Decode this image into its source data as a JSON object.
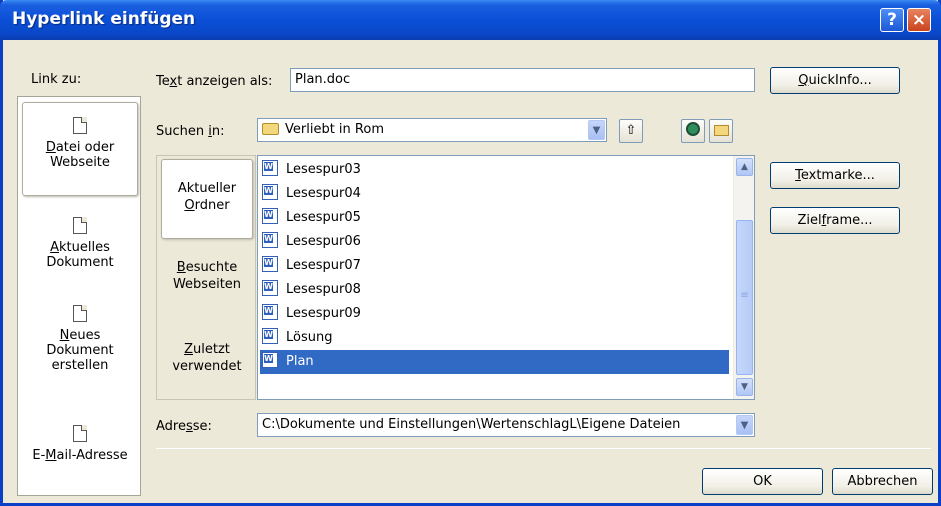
{
  "window": {
    "title": "Hyperlink einfügen",
    "help_glyph": "?",
    "close_glyph": "×"
  },
  "link_to": {
    "label": "Link zu:",
    "items": [
      {
        "l1": "Datei oder",
        "l2": "Webseite",
        "ul": "D",
        "rest": "atei oder",
        "icon": "file-web-icon",
        "selected": true
      },
      {
        "ul": "A",
        "rest": "ktuelles",
        "l2": "Dokument",
        "icon": "current-document-icon",
        "selected": false
      },
      {
        "ul": "N",
        "rest": "eues",
        "l2": "Dokument",
        "l3": "erstellen",
        "icon": "new-document-icon",
        "selected": false
      },
      {
        "pre": "E-",
        "ul": "M",
        "rest": "ail-Adresse",
        "icon": "email-icon",
        "selected": false
      }
    ]
  },
  "display_text": {
    "label_pre": "Te",
    "label_ul": "x",
    "label_post": "t anzeigen als:",
    "value": "Plan.doc"
  },
  "quickinfo_button": {
    "ul": "Q",
    "rest": "uickInfo..."
  },
  "look_in": {
    "label_pre": "Suchen ",
    "label_ul": "i",
    "label_post": "n:",
    "value": "Verliebt in Rom"
  },
  "side_tabs": [
    {
      "l1": "Aktueller",
      "ul": "O",
      "rest": "rdner",
      "selected": true
    },
    {
      "ul": "B",
      "rest": "esuchte",
      "l2": "Webseiten",
      "selected": false
    },
    {
      "ul": "Z",
      "rest": "uletzt",
      "l2": "verwendet",
      "selected": false
    }
  ],
  "files": [
    {
      "name": "Lesespur03",
      "selected": false
    },
    {
      "name": "Lesespur04",
      "selected": false
    },
    {
      "name": "Lesespur05",
      "selected": false
    },
    {
      "name": "Lesespur06",
      "selected": false
    },
    {
      "name": "Lesespur07",
      "selected": false
    },
    {
      "name": "Lesespur08",
      "selected": false
    },
    {
      "name": "Lesespur09",
      "selected": false
    },
    {
      "name": "Lösung",
      "selected": false
    },
    {
      "name": "Plan",
      "selected": true
    }
  ],
  "bookmark_button": {
    "ul": "T",
    "rest": "extmarke..."
  },
  "target_frame_button": {
    "pre": "Ziel",
    "ul": "f",
    "rest": "rame..."
  },
  "address": {
    "label_pre": "Adre",
    "label_ul": "s",
    "label_post": "se:",
    "value": "C:\\Dokumente und Einstellungen\\WertenschlagL\\Eigene Dateien"
  },
  "ok_button": "OK",
  "cancel_button": "Abbrechen",
  "colors": {
    "titlebar": "#0a4fd6",
    "dialog_bg": "#ece9d8",
    "selection": "#316ac5"
  }
}
